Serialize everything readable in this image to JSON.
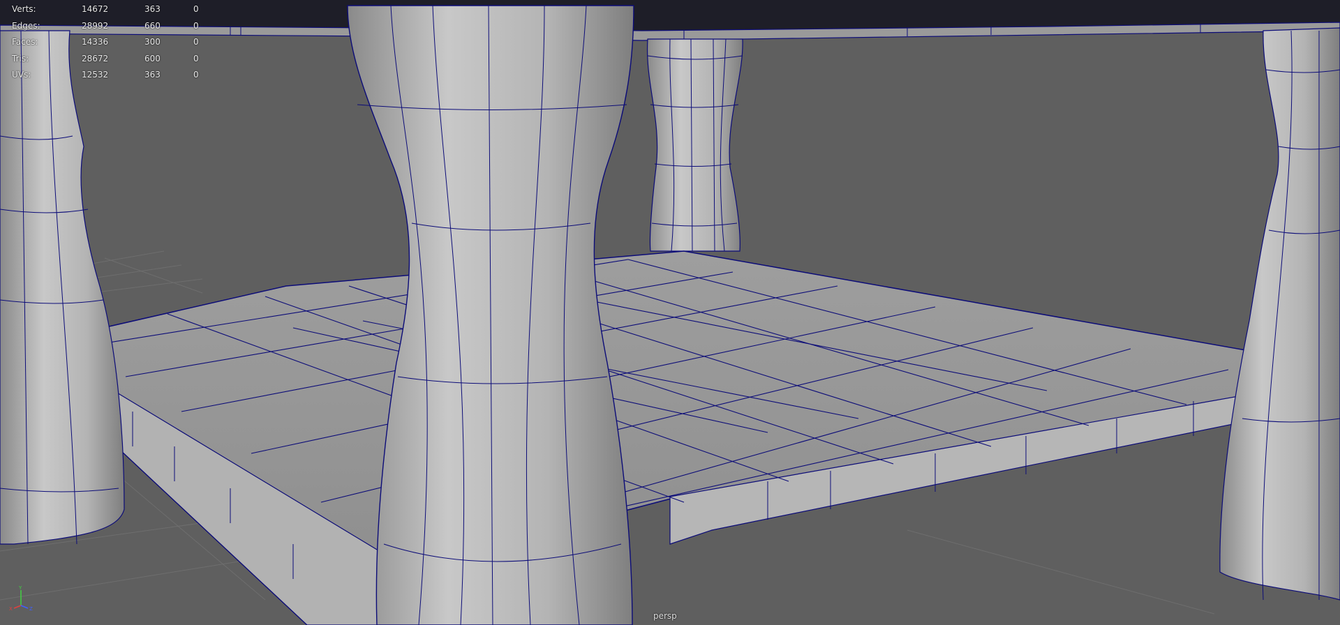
{
  "hud": {
    "rows": [
      {
        "label": "Verts:",
        "v1": "14672",
        "v2": "363",
        "v3": "0"
      },
      {
        "label": "Edges:",
        "v1": "28992",
        "v2": "660",
        "v3": "0"
      },
      {
        "label": "Faces:",
        "v1": "14336",
        "v2": "300",
        "v3": "0"
      },
      {
        "label": "Tris:",
        "v1": "28672",
        "v2": "600",
        "v3": "0"
      },
      {
        "label": "UVs:",
        "v1": "12532",
        "v2": "363",
        "v3": "0"
      }
    ]
  },
  "viewport": {
    "camera_label": "persp"
  },
  "axis_gizmo": {
    "y_label": "Y",
    "x_label": "X",
    "z_label": "Z",
    "x_color": "#e04040",
    "y_color": "#40d040",
    "z_color": "#4060ff"
  },
  "colors": {
    "background": "#5f5f5f",
    "wireframe": "#0c0c78",
    "mesh": "#a8a8a8"
  }
}
